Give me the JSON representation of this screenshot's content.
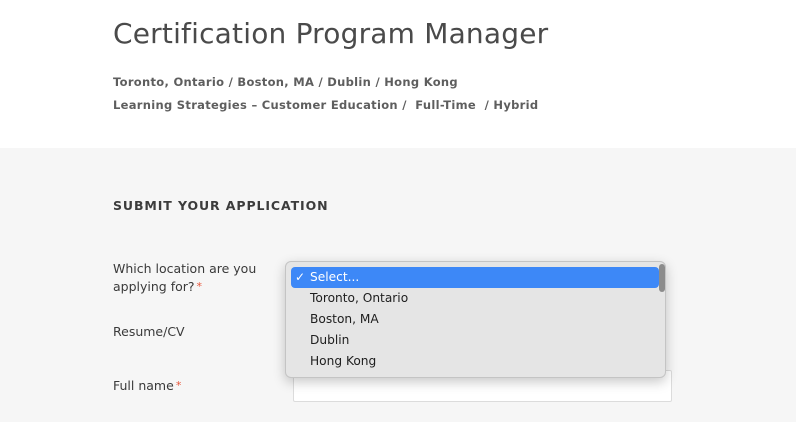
{
  "job": {
    "title": "Certification Program Manager",
    "locations_line": "Toronto, Ontario / Boston, MA / Dublin / Hong Kong",
    "team_line": "Learning Strategies – Customer Education /  Full-Time  / Hybrid"
  },
  "application": {
    "heading": "SUBMIT YOUR APPLICATION",
    "location_label": "Which location are you applying for?",
    "resume_label": "Resume/CV",
    "name_label": "Full name",
    "required_mark": "*"
  },
  "location_select": {
    "selected": "Select...",
    "check_mark": "✓",
    "options": [
      "Select...",
      "Toronto, Ontario",
      "Boston, MA",
      "Dublin",
      "Hong Kong"
    ]
  },
  "colors": {
    "accent": "#3d88f7",
    "required": "#e8553a",
    "form_background": "#f6f6f6"
  }
}
